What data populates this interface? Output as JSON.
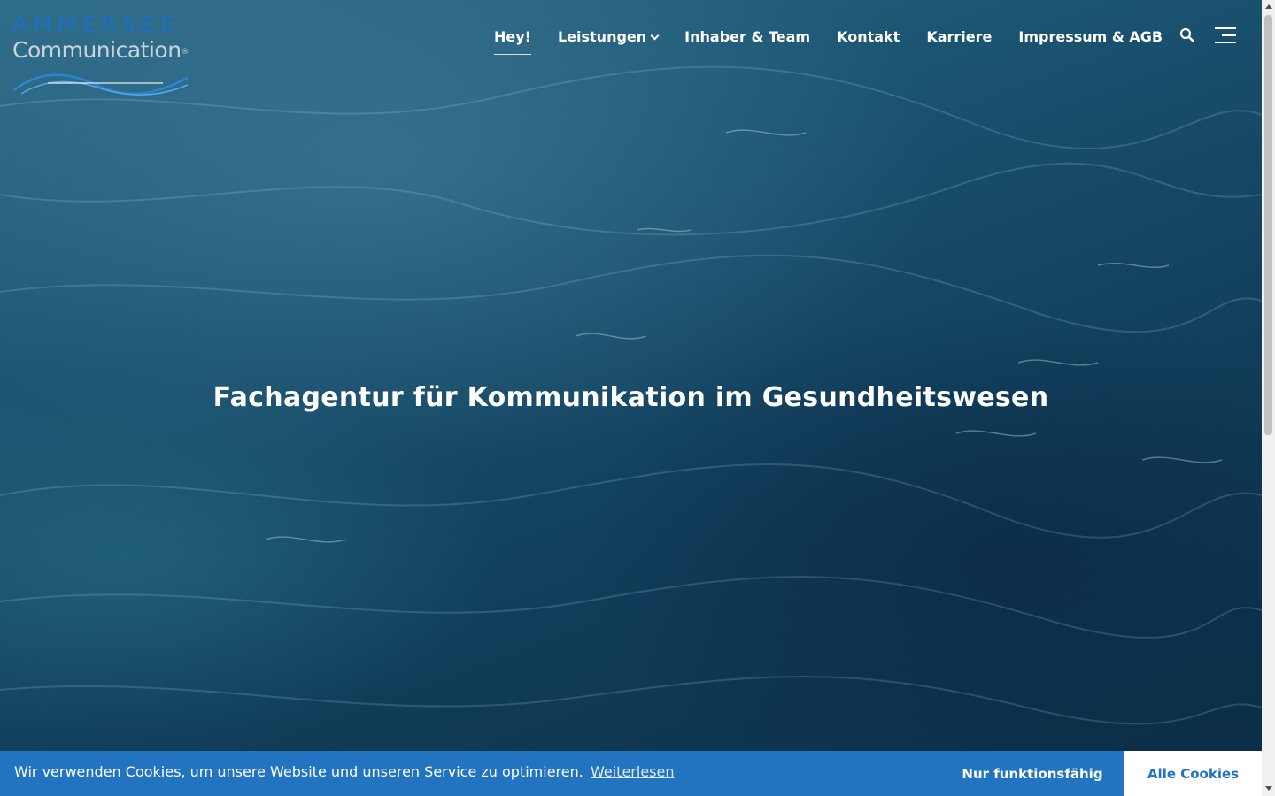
{
  "logo": {
    "line1": "AMMERSEE",
    "line2": "Communication",
    "registered": "®"
  },
  "nav": {
    "items": [
      {
        "label": "Hey!",
        "active": true
      },
      {
        "label": "Leistungen",
        "has_dropdown": true
      },
      {
        "label": "Inhaber & Team"
      },
      {
        "label": "Kontakt"
      },
      {
        "label": "Karriere"
      },
      {
        "label": "Impressum & AGB"
      }
    ]
  },
  "hero": {
    "headline": "Fachagentur für Kommunikation im Gesundheitswesen"
  },
  "cookie_banner": {
    "message": "Wir verwenden Cookies, um unsere Website und unseren Service zu optimieren.",
    "read_more": "Weiterlesen",
    "functional_button": "Nur funktionsfähig",
    "all_button": "Alle Cookies"
  },
  "icons": {
    "search": "search-icon",
    "menu": "hamburger-menu-icon",
    "dropdown": "chevron-down-icon"
  },
  "colors": {
    "brand_blue": "#2274c0",
    "logo_blue": "#1f6fc0",
    "water_dark": "#0b2c45"
  }
}
